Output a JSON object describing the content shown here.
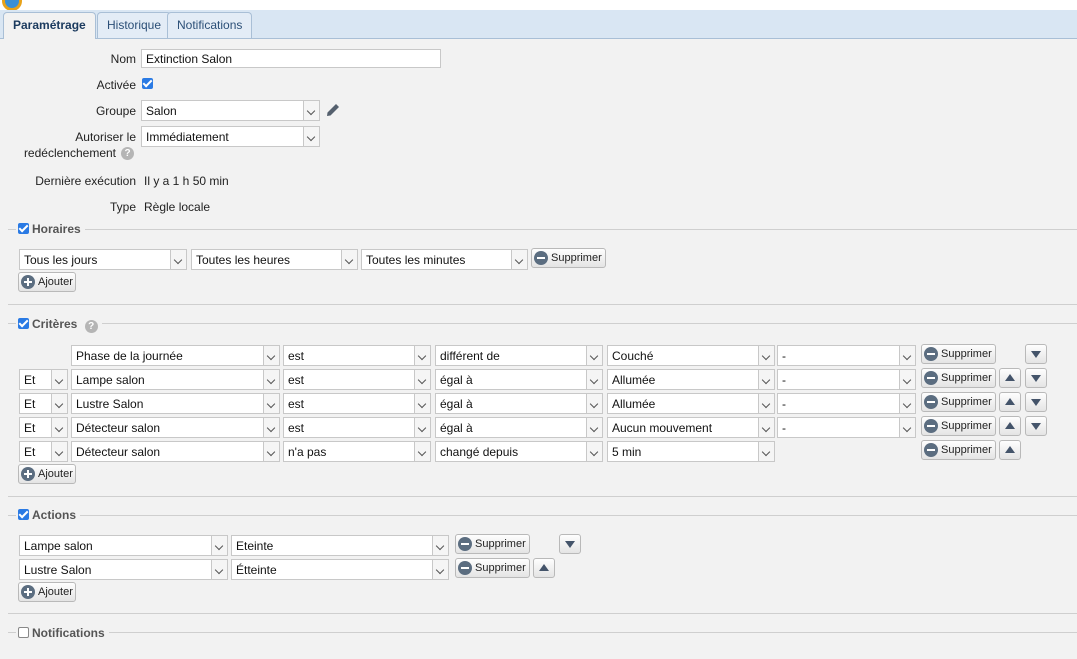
{
  "tabs": [
    {
      "label": "Paramétrage"
    },
    {
      "label": "Historique"
    },
    {
      "label": "Notifications"
    }
  ],
  "form": {
    "nom_label": "Nom",
    "nom_value": "Extinction Salon",
    "activee_label": "Activée",
    "groupe_label": "Groupe",
    "groupe_value": "Salon",
    "autoriser_label_1": "Autoriser le",
    "autoriser_label_2": "redéclenchement",
    "autoriser_value": "Immédiatement",
    "derniere_label": "Dernière exécution",
    "derniere_value": "Il y a 1 h 50 min",
    "type_label": "Type",
    "type_value": "Règle locale"
  },
  "horaires": {
    "legend": "Horaires",
    "jours": "Tous les jours",
    "heures": "Toutes les heures",
    "minutes": "Toutes les minutes"
  },
  "criteres": {
    "legend": "Critères",
    "rows": [
      {
        "op": "",
        "device": "Phase de la journée",
        "verb": "est",
        "cmp": "différent de",
        "value": "Couché",
        "extra": "-"
      },
      {
        "op": "Et",
        "device": "Lampe salon",
        "verb": "est",
        "cmp": "égal à",
        "value": "Allumée",
        "extra": "-"
      },
      {
        "op": "Et",
        "device": "Lustre Salon",
        "verb": "est",
        "cmp": "égal à",
        "value": "Allumée",
        "extra": "-"
      },
      {
        "op": "Et",
        "device": "Détecteur salon",
        "verb": "est",
        "cmp": "égal à",
        "value": "Aucun mouvement",
        "extra": "-"
      },
      {
        "op": "Et",
        "device": "Détecteur salon",
        "verb": "n'a pas",
        "cmp": "changé depuis",
        "value": "5 min",
        "extra": ""
      }
    ]
  },
  "actions": {
    "legend": "Actions",
    "rows": [
      {
        "device": "Lampe salon",
        "value": "Eteinte"
      },
      {
        "device": "Lustre Salon",
        "value": "Étteinte"
      }
    ]
  },
  "notifications": {
    "legend": "Notifications"
  },
  "buttons": {
    "supprimer": "Supprimer",
    "ajouter": "Ajouter"
  },
  "colors": {
    "accent": "#2a7ae4",
    "tabbar": "#d9e6f3"
  }
}
